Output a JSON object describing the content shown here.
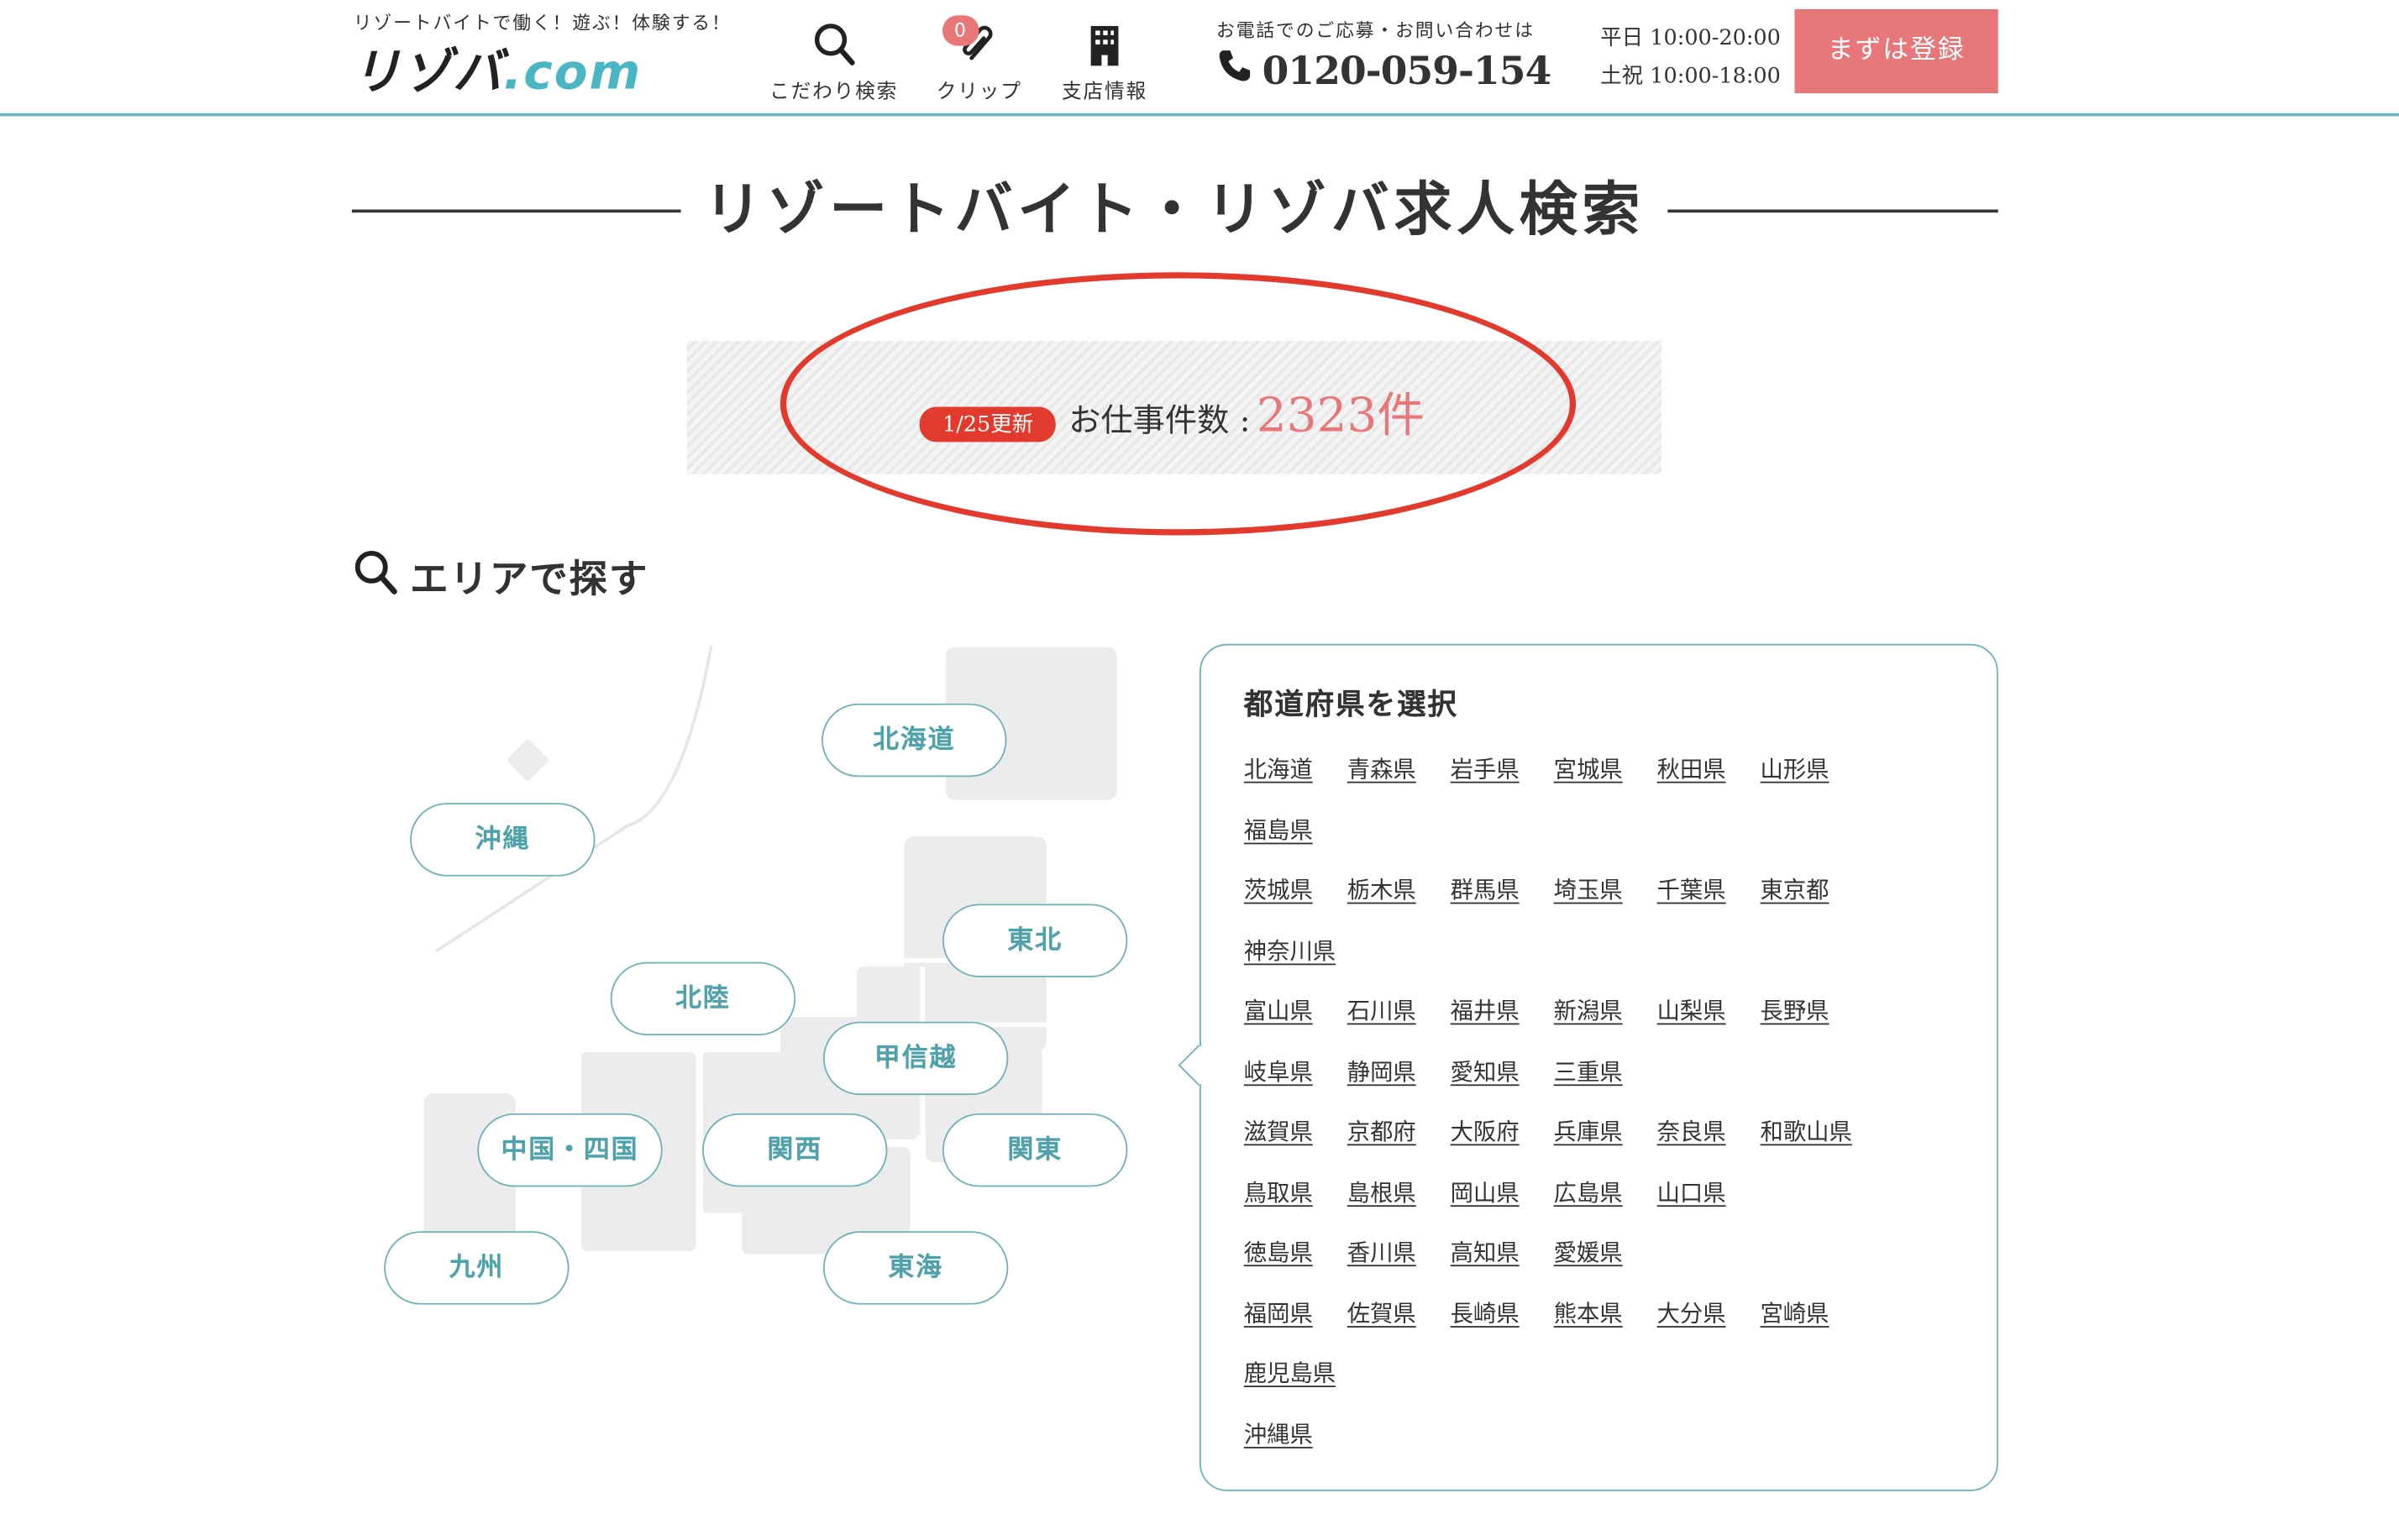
{
  "header": {
    "tagline": "リゾートバイトで働く！遊ぶ！体験する！",
    "logo_main": "リゾバ",
    "logo_com": ".com",
    "nav": [
      {
        "label": "こだわり検索",
        "icon": "search-icon"
      },
      {
        "label": "クリップ",
        "icon": "clip-icon",
        "badge": "0"
      },
      {
        "label": "支店情報",
        "icon": "building-icon"
      }
    ],
    "contact_label": "お電話でのご応募・お問い合わせは",
    "phone": "0120-059-154",
    "hours_weekday": "平日 10:00-20:00",
    "hours_holiday": "土祝 10:00-18:00",
    "register_label": "まずは登録"
  },
  "page_title": "リゾートバイト・リゾバ求人検索",
  "job_count": {
    "updated": "1/25更新",
    "label": "お仕事件数 : ",
    "value": "2323件"
  },
  "area_heading": "エリアで探す",
  "regions": [
    "北海道",
    "沖縄",
    "東北",
    "北陸",
    "甲信越",
    "中国・四国",
    "関西",
    "関東",
    "九州",
    "東海"
  ],
  "prefecture_panel": {
    "title": "都道府県を選択",
    "rows": [
      [
        "北海道",
        "青森県",
        "岩手県",
        "宮城県",
        "秋田県",
        "山形県"
      ],
      [
        "福島県"
      ],
      [
        "茨城県",
        "栃木県",
        "群馬県",
        "埼玉県",
        "千葉県",
        "東京都"
      ],
      [
        "神奈川県"
      ],
      [
        "富山県",
        "石川県",
        "福井県",
        "新潟県",
        "山梨県",
        "長野県"
      ],
      [
        "岐阜県",
        "静岡県",
        "愛知県",
        "三重県"
      ],
      [
        "滋賀県",
        "京都府",
        "大阪府",
        "兵庫県",
        "奈良県",
        "和歌山県"
      ],
      [
        "鳥取県",
        "島根県",
        "岡山県",
        "広島県",
        "山口県"
      ],
      [
        "徳島県",
        "香川県",
        "高知県",
        "愛媛県"
      ],
      [
        "福岡県",
        "佐賀県",
        "長崎県",
        "熊本県",
        "大分県",
        "宮崎県"
      ],
      [
        "鹿児島県"
      ],
      [
        "沖縄県"
      ]
    ]
  },
  "colors": {
    "accent_teal": "#6bb7bf",
    "accent_pink": "#e8777a",
    "highlight_red": "#e23b2e",
    "map_gray": "#ececec"
  }
}
